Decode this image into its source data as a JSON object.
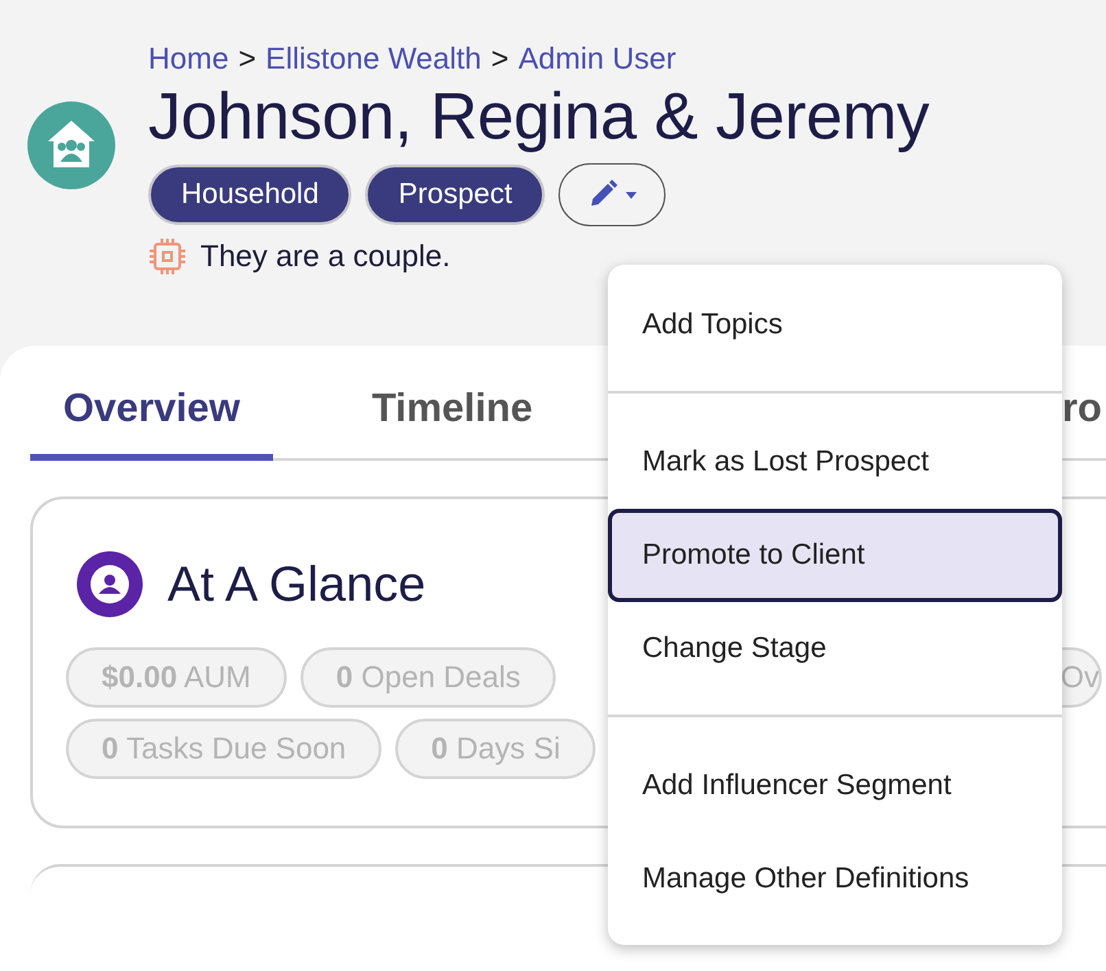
{
  "breadcrumb": [
    "Home",
    "Ellistone Wealth",
    "Admin User"
  ],
  "breadcrumb_separator": ">",
  "title": "Johnson, Regina & Jeremy",
  "badges": [
    "Household",
    "Prospect"
  ],
  "note": "They are a couple.",
  "tabs": [
    {
      "label": "Overview",
      "selected": true
    },
    {
      "label": "Timeline",
      "selected": false
    },
    {
      "label": "ro",
      "selected": false
    }
  ],
  "at_a_glance": {
    "title": "At A Glance",
    "chip_rows": [
      [
        {
          "value": "$0.00",
          "label": "AUM"
        },
        {
          "value": "0",
          "label": "Open Deals"
        },
        {
          "label": "Ov"
        }
      ],
      [
        {
          "value": "0",
          "label": "Tasks Due Soon"
        },
        {
          "value": "0",
          "label": "Days Si"
        }
      ]
    ]
  },
  "menu": {
    "groups": [
      [
        {
          "label": "Add Topics",
          "selected": false
        }
      ],
      [
        {
          "label": "Mark as Lost Prospect",
          "selected": false
        },
        {
          "label": "Promote to Client",
          "selected": true
        },
        {
          "label": "Change Stage",
          "selected": false
        }
      ],
      [
        {
          "label": "Add Influencer Segment",
          "selected": false
        },
        {
          "label": "Manage Other Definitions",
          "selected": false
        }
      ]
    ]
  }
}
